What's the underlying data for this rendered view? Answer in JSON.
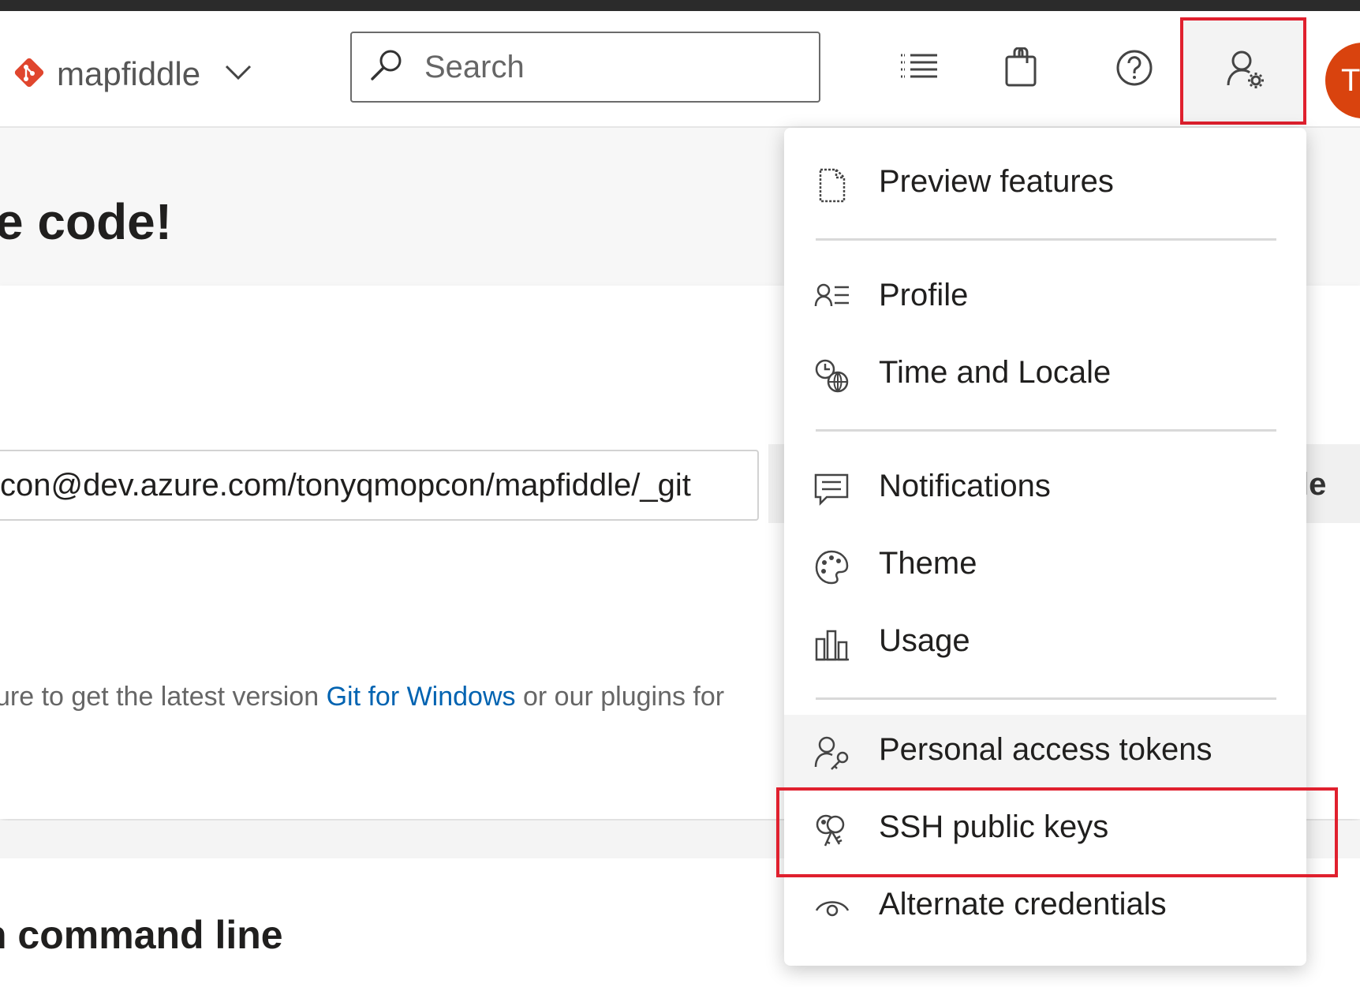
{
  "header": {
    "project_name": "mapfiddle",
    "search_placeholder": "Search",
    "avatar_initials": "TV",
    "icons": [
      "project-logo-icon",
      "chevron-down-icon",
      "search-icon",
      "work-items-list-icon",
      "marketplace-bag-icon",
      "help-icon",
      "user-settings-icon"
    ]
  },
  "page": {
    "hero_title": "e code!",
    "clone_url": "con@dev.azure.com/tonyqmopcon/mapfiddle/_git",
    "clone_button_label": "le",
    "help_text_before": "ure to get the latest version ",
    "help_link": "Git for Windows",
    "help_text_after": " or our plugins for",
    "section_title": "n command line"
  },
  "menu": {
    "items": [
      {
        "label": "Preview features",
        "icon": "preview-features-icon"
      },
      {
        "label": "Profile",
        "icon": "profile-icon"
      },
      {
        "label": "Time and Locale",
        "icon": "time-locale-icon"
      },
      {
        "label": "Notifications",
        "icon": "notifications-icon"
      },
      {
        "label": "Theme",
        "icon": "theme-palette-icon"
      },
      {
        "label": "Usage",
        "icon": "usage-chart-icon"
      },
      {
        "label": "Personal access tokens",
        "icon": "personal-access-tokens-icon"
      },
      {
        "label": "SSH public keys",
        "icon": "ssh-keys-icon"
      },
      {
        "label": "Alternate credentials",
        "icon": "alternate-credentials-icon"
      }
    ]
  },
  "colors": {
    "highlight_red": "#e0202e",
    "avatar_bg": "#d9430e",
    "link_blue": "#0063b1",
    "logo_red": "#e0462e"
  }
}
